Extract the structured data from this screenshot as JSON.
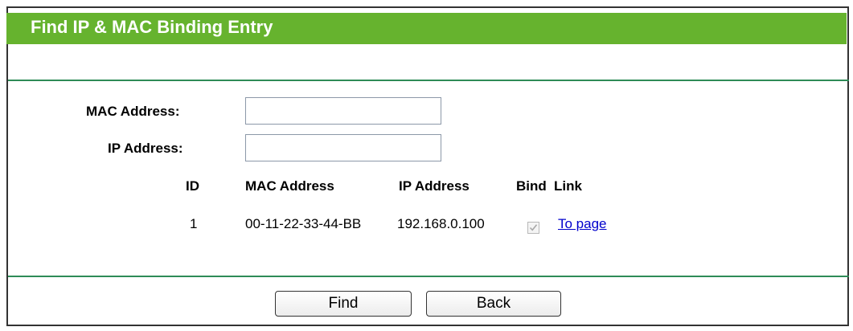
{
  "header": {
    "title": "Find IP & MAC Binding Entry"
  },
  "form": {
    "mac_label": "MAC Address:",
    "mac_value": "",
    "ip_label": "IP Address:",
    "ip_value": ""
  },
  "table": {
    "columns": [
      "ID",
      "MAC Address",
      "IP Address",
      "Bind",
      "Link"
    ],
    "rows": [
      {
        "id": "1",
        "mac": "00-11-22-33-44-BB",
        "ip": "192.168.0.100",
        "bind": true,
        "link": "To page"
      }
    ]
  },
  "buttons": {
    "find": "Find",
    "back": "Back"
  },
  "colors": {
    "title_bar": "#66b32e",
    "divider": "#2e8b57",
    "link": "#0000cc"
  }
}
